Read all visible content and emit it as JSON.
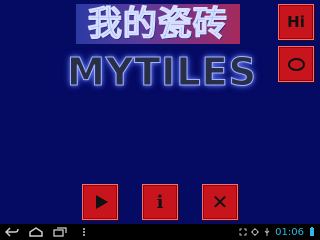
{
  "game": {
    "title_cn": "我的瓷砖",
    "logo": "MYTILES"
  },
  "buttons": {
    "hi_label": "Hi",
    "info_label": "i"
  },
  "status_bar": {
    "time": "01:06"
  },
  "colors": {
    "background": "#050a63",
    "button": "#c8141c",
    "clock": "#33b5e5"
  },
  "icons": [
    "back-icon",
    "home-icon",
    "recent-apps-icon",
    "menu-icon",
    "screenshot-icon",
    "gps-icon",
    "usb-icon",
    "battery-icon",
    "play-icon",
    "info-icon",
    "close-icon",
    "circle-icon"
  ]
}
